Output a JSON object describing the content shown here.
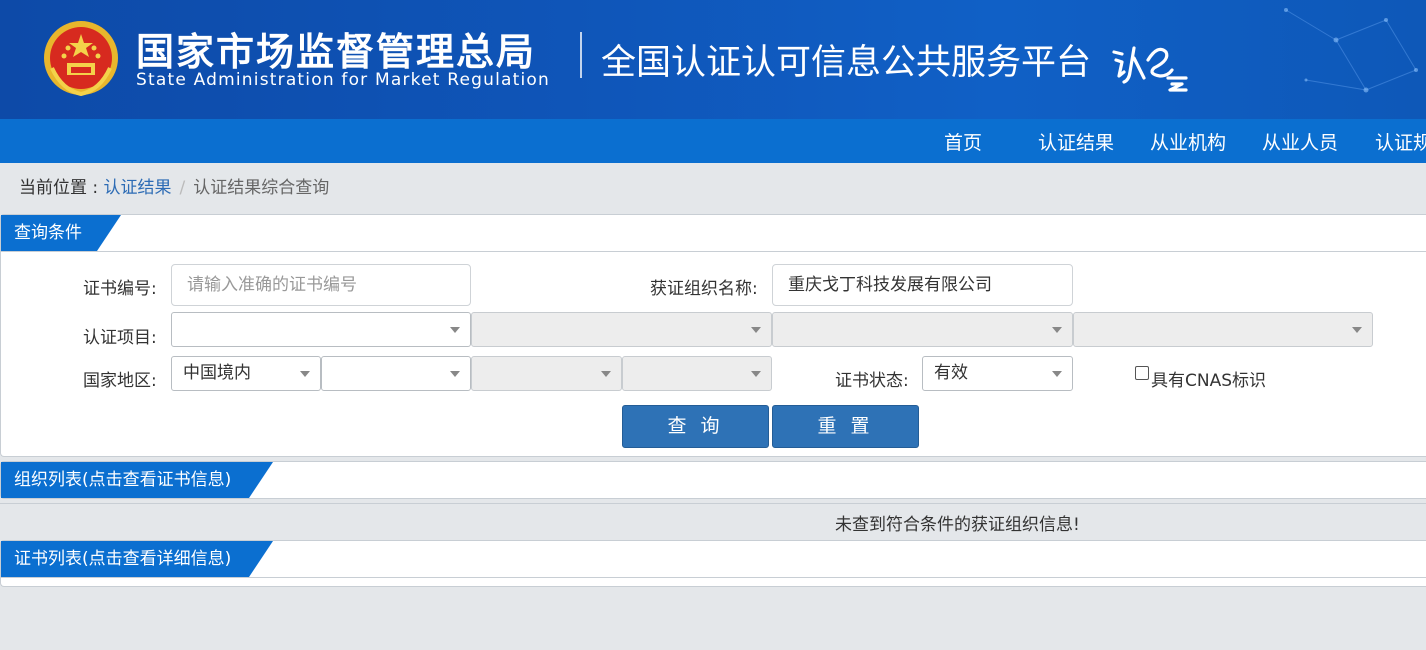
{
  "header": {
    "agency_cn": "国家市场监督管理总局",
    "agency_en": "State Administration  for  Market Regulation",
    "platform_title": "全国认证认可信息公共服务平台",
    "logo_text": "认e云",
    "emblem_icon": "national-emblem-icon"
  },
  "nav": {
    "items": [
      {
        "label": "首页"
      },
      {
        "label": "认证结果"
      },
      {
        "label": "从业机构"
      },
      {
        "label": "从业人员"
      },
      {
        "label": "认证规"
      }
    ]
  },
  "breadcrumb": {
    "prefix": "当前位置 : ",
    "link": "认证结果",
    "separator": "/",
    "current": "认证结果综合查询"
  },
  "query_panel": {
    "title": "查询条件",
    "cert_no": {
      "label": "证书编号:",
      "placeholder": "请输入准确的证书编号",
      "value": ""
    },
    "org_name": {
      "label": "获证组织名称:",
      "value": "重庆戈丁科技发展有限公司"
    },
    "cert_project": {
      "label": "认证项目:",
      "selects": [
        "",
        "",
        "",
        ""
      ]
    },
    "region": {
      "label": "国家地区:",
      "selects": [
        "中国境内",
        "",
        "",
        ""
      ]
    },
    "cert_status": {
      "label": "证书状态:",
      "value": "有效"
    },
    "cnas": {
      "label": "具有CNAS标识",
      "checked": false
    },
    "buttons": {
      "search": "查 询",
      "reset": "重 置"
    }
  },
  "org_list": {
    "title": "组织列表(点击查看证书信息)",
    "empty_message": "未查到符合条件的获证组织信息!"
  },
  "cert_list": {
    "title": "证书列表(点击查看详细信息)"
  },
  "colors": {
    "banner": "#0f55b8",
    "navbar": "#0b6fd0",
    "button": "#2e72b6",
    "link": "#2d6cb5"
  }
}
